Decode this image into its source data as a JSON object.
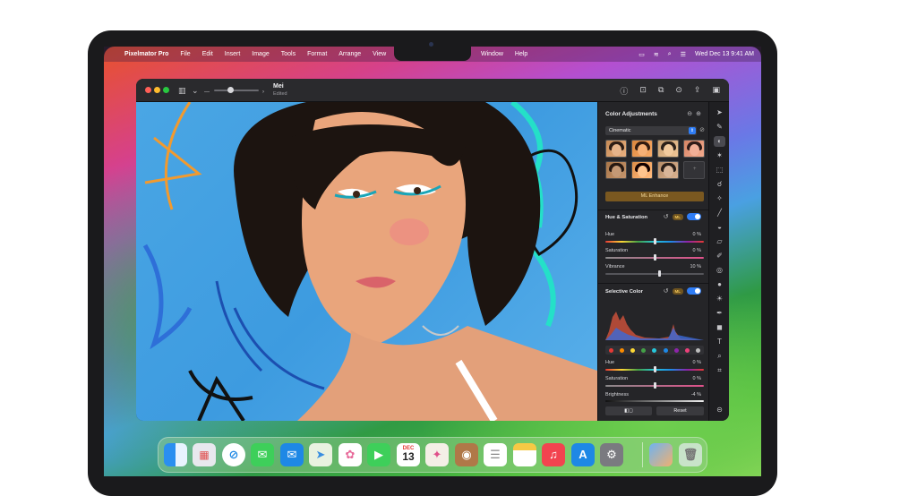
{
  "menubar": {
    "apple_glyph": "",
    "app_name": "Pixelmator Pro",
    "items": [
      "File",
      "Edit",
      "Insert",
      "Image",
      "Tools",
      "Format",
      "Arrange",
      "View"
    ],
    "items_right_of_notch": [
      "Window",
      "Help"
    ],
    "clock": "Wed Dec 13  9:41 AM"
  },
  "document": {
    "name": "Mei",
    "status": "Edited"
  },
  "panel": {
    "title": "Color Adjustments",
    "preset": "Cinematic",
    "ml_enhance": "ML Enhance",
    "ml_badge": "ML",
    "hue_saturation": {
      "title": "Hue & Saturation",
      "sliders": [
        {
          "label": "Hue",
          "value": "0 %"
        },
        {
          "label": "Saturation",
          "value": "0 %"
        },
        {
          "label": "Vibrance",
          "value": "10 %"
        }
      ]
    },
    "selective_color": {
      "title": "Selective Color",
      "sliders": [
        {
          "label": "Hue",
          "value": "0 %"
        },
        {
          "label": "Saturation",
          "value": "0 %"
        },
        {
          "label": "Brightness",
          "value": "-4 %"
        }
      ]
    },
    "reset_label": "Reset"
  },
  "colors": {
    "accent": "#2f7df6",
    "ml_gold": "#f2c65a",
    "swatches": [
      "#e53935",
      "#fb8c00",
      "#fdd835",
      "#43a047",
      "#26c6da",
      "#1e88e5",
      "#8e24aa",
      "#ec407a",
      "#bdbdbd"
    ]
  },
  "dock": {
    "calendar_month": "DEC",
    "calendar_day": "13"
  }
}
